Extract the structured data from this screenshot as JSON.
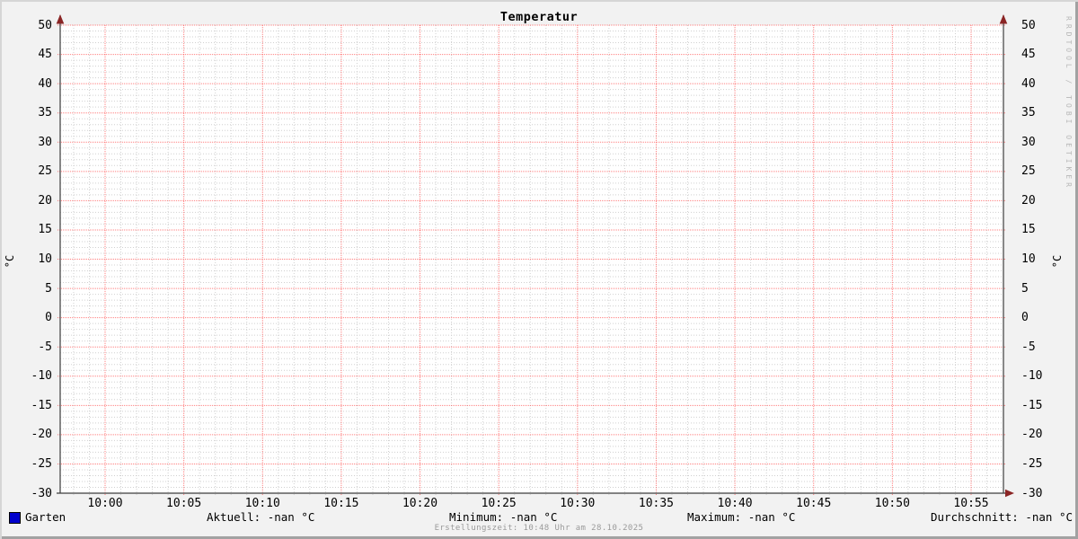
{
  "title": "Temperatur",
  "watermark": "RRDTOOL / TOBI OETIKER",
  "chart_data": {
    "type": "line",
    "title": "Temperatur",
    "ylabel_left": "°C",
    "ylabel_right": "°C",
    "ylim": [
      -30,
      50
    ],
    "y_tick_step": 5,
    "y_ticks": [
      50,
      45,
      40,
      35,
      30,
      25,
      20,
      15,
      10,
      5,
      0,
      -5,
      -10,
      -15,
      -20,
      -25,
      -30
    ],
    "x_ticks": [
      "10:00",
      "10:05",
      "10:10",
      "10:15",
      "10:20",
      "10:25",
      "10:30",
      "10:35",
      "10:40",
      "10:45",
      "10:50",
      "10:55"
    ],
    "x_minor_per_major": 5,
    "y_minor_per_major": 5,
    "grid": true,
    "series": [
      {
        "name": "Garten",
        "color": "#0000cc",
        "values": []
      }
    ],
    "colors": {
      "major_grid": "rgba(255,0,0,0.5)",
      "minor_grid": "#d0d0d0",
      "axis": "#3d3d3d",
      "arrow": "#8b2525",
      "canvas": "#ffffff",
      "background": "#f2f2f2"
    }
  },
  "legend": {
    "series_label": "Garten",
    "series_color": "#0000cc",
    "stats": [
      "Aktuell: -nan °C",
      "Minimum: -nan °C",
      "Maximum: -nan °C",
      "Durchschnitt: -nan °C"
    ]
  },
  "footer": {
    "creation_time": "Erstellungszeit: 10:48 Uhr am 28.10.2025"
  }
}
